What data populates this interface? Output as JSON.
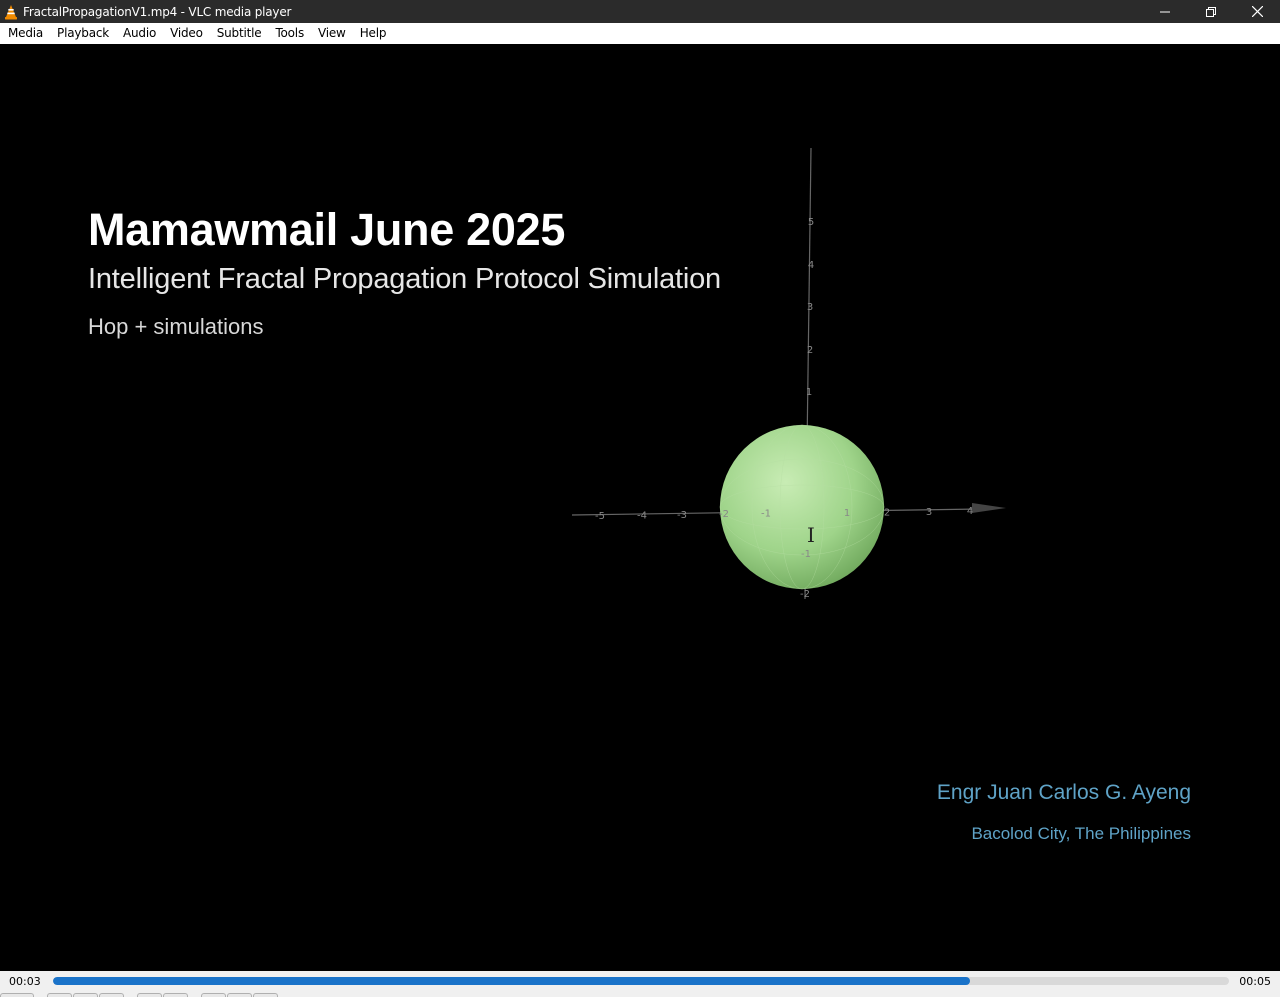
{
  "window": {
    "title": "FractalPropagationV1.mp4 - VLC media player",
    "icon": "vlc-cone-icon",
    "buttons": [
      "minimize-icon",
      "restore-icon",
      "close-icon"
    ]
  },
  "menu": [
    "Media",
    "Playback",
    "Audio",
    "Video",
    "Subtitle",
    "Tools",
    "View",
    "Help"
  ],
  "video": {
    "title": "Mamawmail June 2025",
    "subtitle": "Intelligent Fractal Propagation Protocol Simulation",
    "subsubtitle": "Hop + simulations",
    "author": "Engr Juan Carlos G. Ayeng",
    "location": "Bacolod City, The Philippines",
    "axis_labels": {
      "x": [
        "-5",
        "-4",
        "-3",
        "-2",
        "-1",
        "1",
        "2",
        "3",
        "4"
      ],
      "vertical": [
        "5",
        "4",
        "3",
        "2",
        "1",
        "-1",
        "-2"
      ]
    },
    "sphere_color": "#9fd48a"
  },
  "playback": {
    "current_time": "00:03",
    "total_time": "00:05",
    "progress": 0.78
  },
  "colors": {
    "titlebar": "#2b2b2b",
    "accent": "#1a73c9",
    "credit_text": "#5fa3c7"
  }
}
